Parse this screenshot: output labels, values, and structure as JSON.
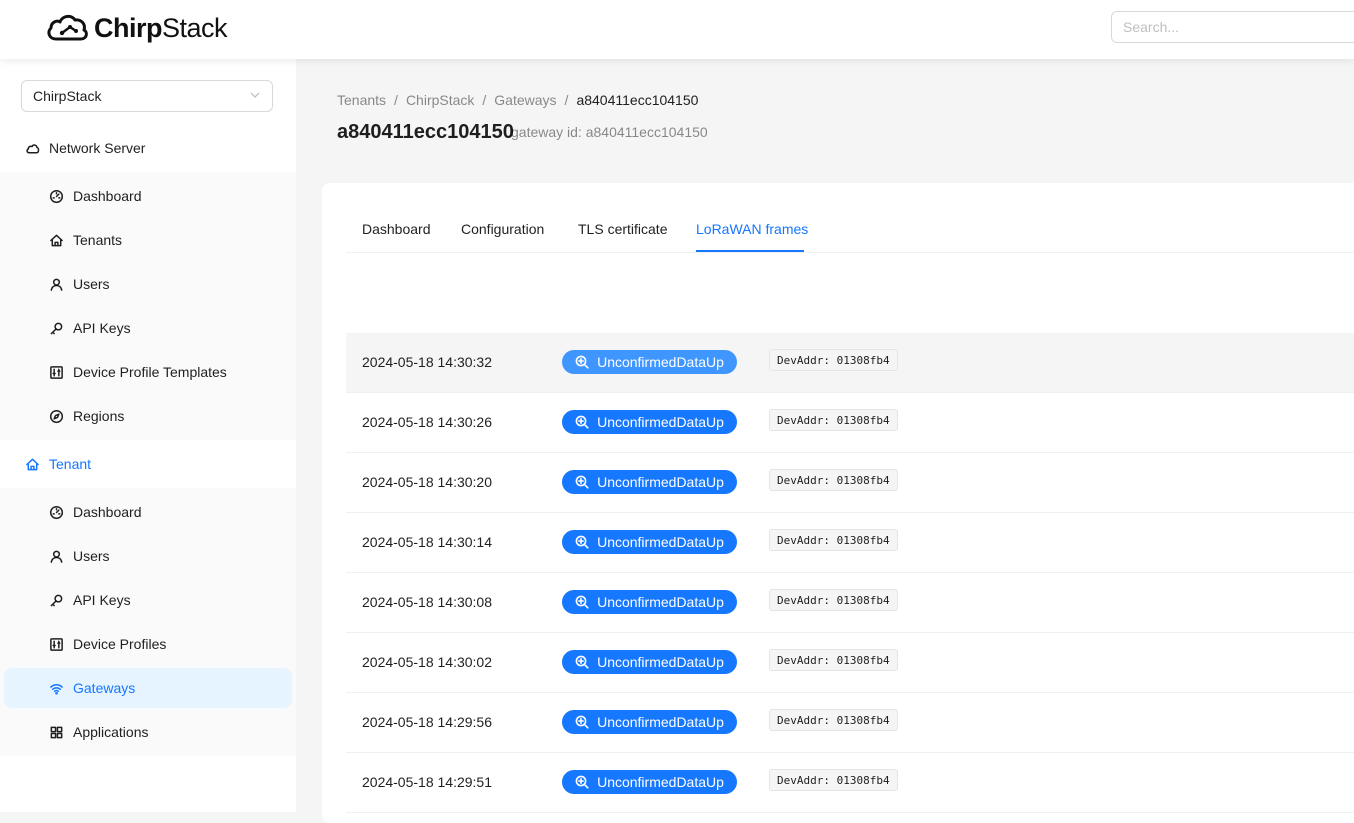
{
  "header": {
    "logo_text_bold": "Chirp",
    "logo_text_regular": "Stack",
    "search_placeholder": "Search..."
  },
  "sidebar": {
    "tenant_select_value": "ChirpStack",
    "network_server": {
      "label": "Network Server",
      "items": [
        {
          "label": "Dashboard",
          "icon": "dashboard-icon"
        },
        {
          "label": "Tenants",
          "icon": "home-icon"
        },
        {
          "label": "Users",
          "icon": "user-icon"
        },
        {
          "label": "API Keys",
          "icon": "key-icon"
        },
        {
          "label": "Device Profile Templates",
          "icon": "sliders-icon"
        },
        {
          "label": "Regions",
          "icon": "compass-icon"
        }
      ]
    },
    "tenant": {
      "label": "Tenant",
      "items": [
        {
          "label": "Dashboard",
          "icon": "dashboard-icon"
        },
        {
          "label": "Users",
          "icon": "user-icon"
        },
        {
          "label": "API Keys",
          "icon": "key-icon"
        },
        {
          "label": "Device Profiles",
          "icon": "sliders-icon"
        },
        {
          "label": "Gateways",
          "icon": "wifi-icon"
        },
        {
          "label": "Applications",
          "icon": "grid-icon"
        }
      ]
    }
  },
  "breadcrumb": [
    "Tenants",
    "ChirpStack",
    "Gateways",
    "a840411ecc104150"
  ],
  "page": {
    "title": "a840411ecc104150",
    "subtitle": "gateway id: a840411ecc104150"
  },
  "tabs": [
    "Dashboard",
    "Configuration",
    "TLS certificate",
    "LoRaWAN frames"
  ],
  "active_tab": "LoRaWAN frames",
  "colors": {
    "primary": "#1677ff",
    "active_bg": "#e6f4ff"
  },
  "frames": [
    {
      "time": "2024-05-18 14:30:32",
      "type": "UnconfirmedDataUp",
      "devaddr": "DevAddr: 01308fb4"
    },
    {
      "time": "2024-05-18 14:30:26",
      "type": "UnconfirmedDataUp",
      "devaddr": "DevAddr: 01308fb4"
    },
    {
      "time": "2024-05-18 14:30:20",
      "type": "UnconfirmedDataUp",
      "devaddr": "DevAddr: 01308fb4"
    },
    {
      "time": "2024-05-18 14:30:14",
      "type": "UnconfirmedDataUp",
      "devaddr": "DevAddr: 01308fb4"
    },
    {
      "time": "2024-05-18 14:30:08",
      "type": "UnconfirmedDataUp",
      "devaddr": "DevAddr: 01308fb4"
    },
    {
      "time": "2024-05-18 14:30:02",
      "type": "UnconfirmedDataUp",
      "devaddr": "DevAddr: 01308fb4"
    },
    {
      "time": "2024-05-18 14:29:56",
      "type": "UnconfirmedDataUp",
      "devaddr": "DevAddr: 01308fb4"
    },
    {
      "time": "2024-05-18 14:29:51",
      "type": "UnconfirmedDataUp",
      "devaddr": "DevAddr: 01308fb4"
    }
  ]
}
